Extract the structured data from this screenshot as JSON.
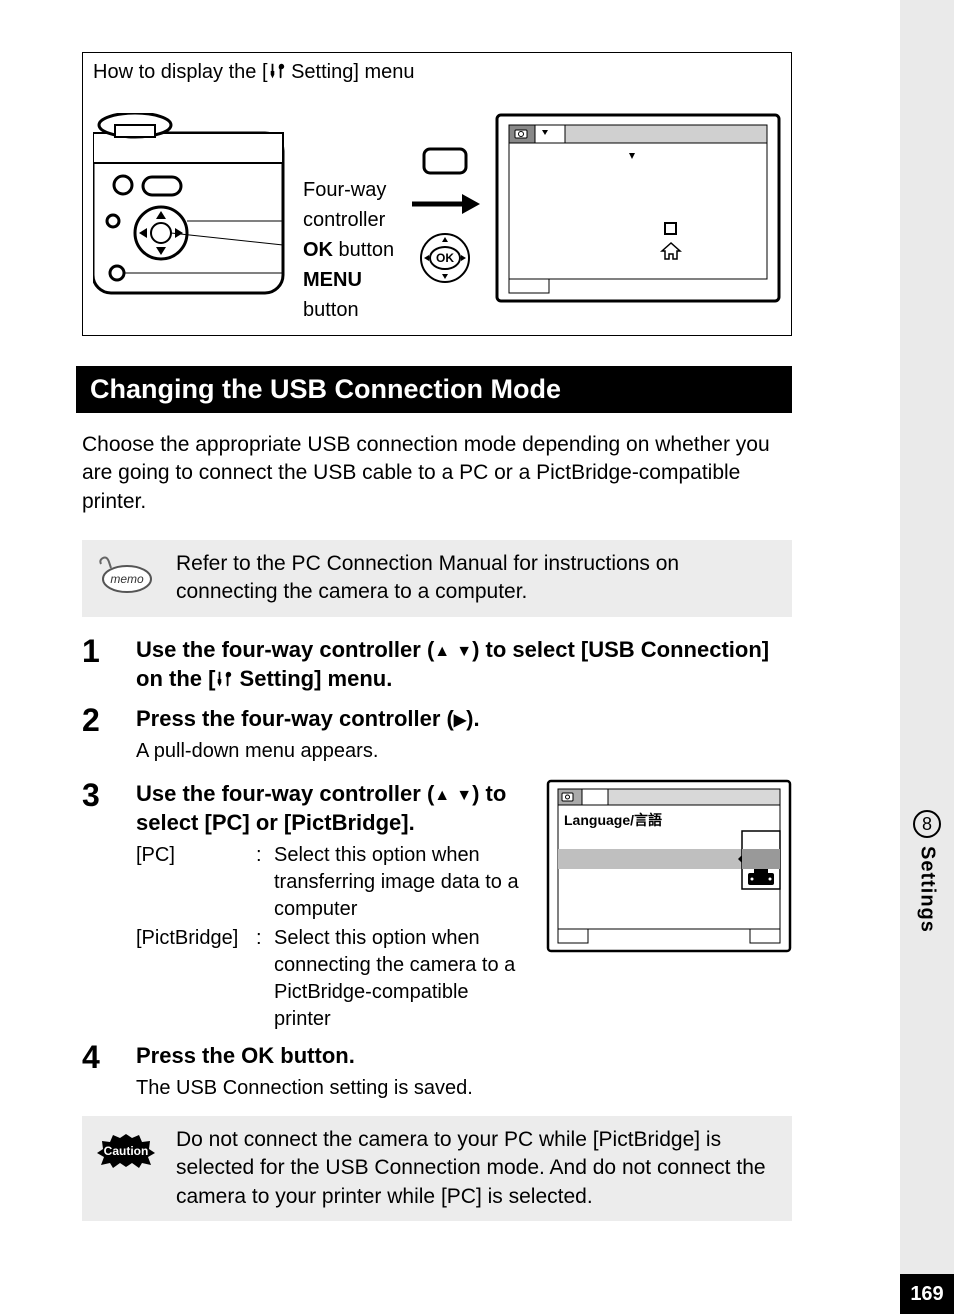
{
  "diagram": {
    "title_prefix": "How to display the [",
    "title_suffix": " Setting] menu",
    "labels": {
      "fourway": "Four-way controller",
      "ok_bold": "OK",
      "ok_rest": " button",
      "menu_bold": "MENU",
      "menu_rest": " button"
    }
  },
  "section_heading": "Changing the USB Connection Mode",
  "intro": "Choose the appropriate USB connection mode depending on whether you are going to connect the USB cable to a PC or a PictBridge-compatible printer.",
  "memo": "Refer to the PC Connection Manual for instructions on connecting the camera to a computer.",
  "steps": {
    "s1": {
      "num": "1",
      "title_a": "Use the four-way controller (",
      "title_b": ") to select [USB Connection] on the [",
      "title_c": " Setting] menu."
    },
    "s2": {
      "num": "2",
      "title_a": "Press the four-way controller (",
      "title_b": ").",
      "desc": "A pull-down menu appears."
    },
    "s3": {
      "num": "3",
      "title_a": "Use the four-way controller (",
      "title_b": ") to select [PC] or [PictBridge].",
      "opt1_label": "[PC]",
      "opt1_text": "Select this option when transferring image data to a computer",
      "opt2_label": "[PictBridge]",
      "opt2_text": "Select this option when connecting the camera to a PictBridge-compatible printer"
    },
    "s4": {
      "num": "4",
      "title_a": "Press the ",
      "title_ok": "OK",
      "title_b": " button.",
      "desc": "The USB Connection setting is saved."
    }
  },
  "lcd2": {
    "tab_label": "Language/言語"
  },
  "caution": "Do not connect the camera to your PC while [PictBridge] is selected for the USB Connection mode. And do not connect the camera to your printer while [PC] is selected.",
  "sidebar": {
    "chapter": "8",
    "label": "Settings"
  },
  "page_number": "169",
  "memo_badge": "memo",
  "caution_badge": "Caution"
}
